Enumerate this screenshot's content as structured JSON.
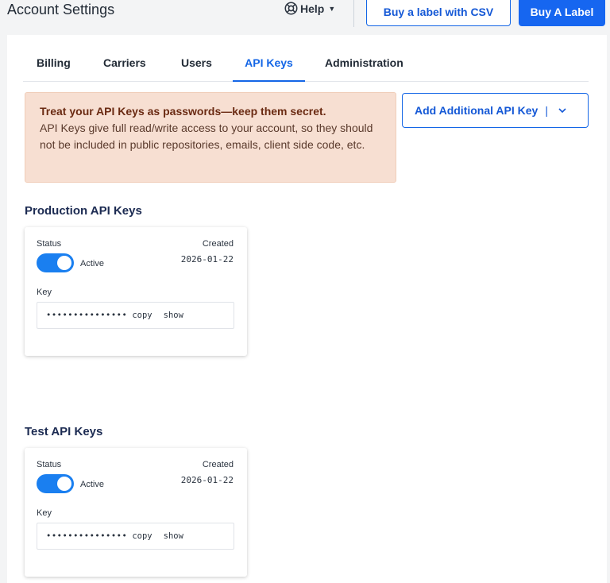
{
  "header": {
    "title": "Account Settings",
    "help_label": "Help",
    "buy_csv_label": "Buy a label with CSV",
    "buy_label": "Buy A Label"
  },
  "tabs": [
    {
      "label": "Billing",
      "active": false
    },
    {
      "label": "Carriers",
      "active": false
    },
    {
      "label": "Users",
      "active": false
    },
    {
      "label": "API Keys",
      "active": true
    },
    {
      "label": "Administration",
      "active": false
    }
  ],
  "alert": {
    "title": "Treat your API Keys as passwords—keep them secret.",
    "body": "API Keys give full read/write access to your account, so they should not be included in public repositories, emails, client side code, etc."
  },
  "add_key_button": "Add Additional API Key",
  "sections": [
    {
      "title": "Production API Keys",
      "status_label": "Status",
      "status_value": "Active",
      "created_label": "Created",
      "created_date": "2026-01-22",
      "key_label": "Key",
      "key_masked": "•••••••••••••••",
      "copy_label": "copy",
      "show_label": "show"
    },
    {
      "title": "Test API Keys",
      "status_label": "Status",
      "status_value": "Active",
      "created_label": "Created",
      "created_date": "2026-01-22",
      "key_label": "Key",
      "key_masked": "•••••••••••••••",
      "copy_label": "copy",
      "show_label": "show"
    }
  ],
  "colors": {
    "accent": "#1466e6",
    "alert_bg": "#f7dfd2",
    "toggle_on": "#1a7ff0"
  }
}
